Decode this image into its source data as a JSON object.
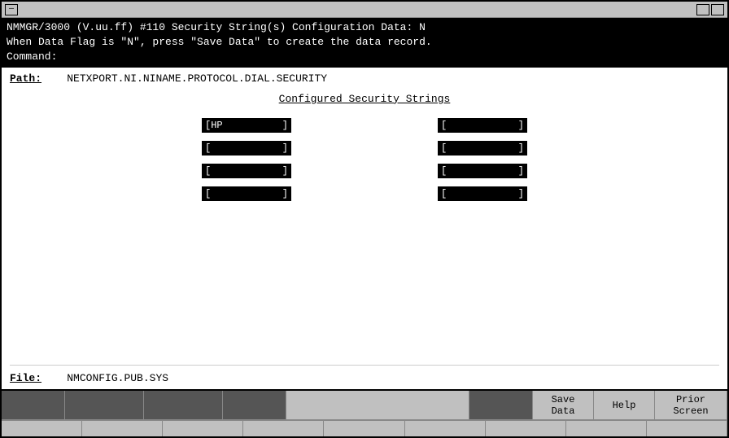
{
  "window": {
    "title": "NMMGR/3000"
  },
  "header": {
    "line1": "NMMGR/3000 (V.uu.ff) #110  Security String(s) Configuration        Data: N",
    "line2": "When Data Flag is \"N\", press \"Save Data\" to create the data record.",
    "line3": "Command:"
  },
  "path": {
    "label": "Path:",
    "value": "NETXPORT.NI.NINAME.PROTOCOL.DIAL.SECURITY"
  },
  "section_title": "Configured Security Strings",
  "fields": [
    [
      {
        "value": "HP",
        "has_text": true
      },
      {
        "value": "",
        "has_text": false
      }
    ],
    [
      {
        "value": "",
        "has_text": false
      },
      {
        "value": "",
        "has_text": false
      }
    ],
    [
      {
        "value": "",
        "has_text": false
      },
      {
        "value": "",
        "has_text": false
      }
    ],
    [
      {
        "value": "",
        "has_text": false
      },
      {
        "value": "",
        "has_text": false
      }
    ]
  ],
  "file": {
    "label": "File:",
    "value": "NMCONFIG.PUB.SYS"
  },
  "buttons": {
    "f1_label": "",
    "f2_label": "",
    "f3_label": "",
    "f4_label": "",
    "f5_label": "",
    "f6_label": "",
    "f7_label": "Save\nData",
    "f8_label": "Help",
    "f9_label": "Prior\nScreen"
  }
}
